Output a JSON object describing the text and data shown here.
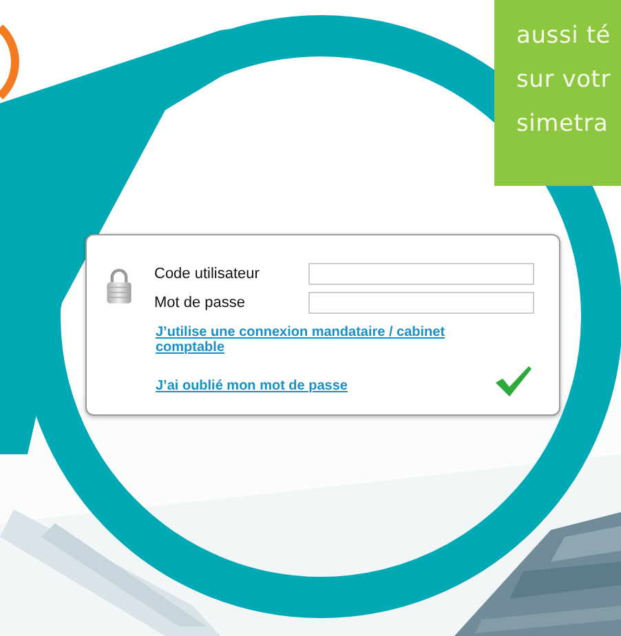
{
  "promo": {
    "lines": [
      "aussi té",
      "sur votr",
      "simetra"
    ]
  },
  "login": {
    "fields": [
      {
        "label": "Code utilisateur"
      },
      {
        "label": "Mot de passe"
      }
    ],
    "links": [
      "J’utilise une connexion mandataire / cabinet comptable",
      "J’ai oublié mon mot de passe"
    ]
  }
}
